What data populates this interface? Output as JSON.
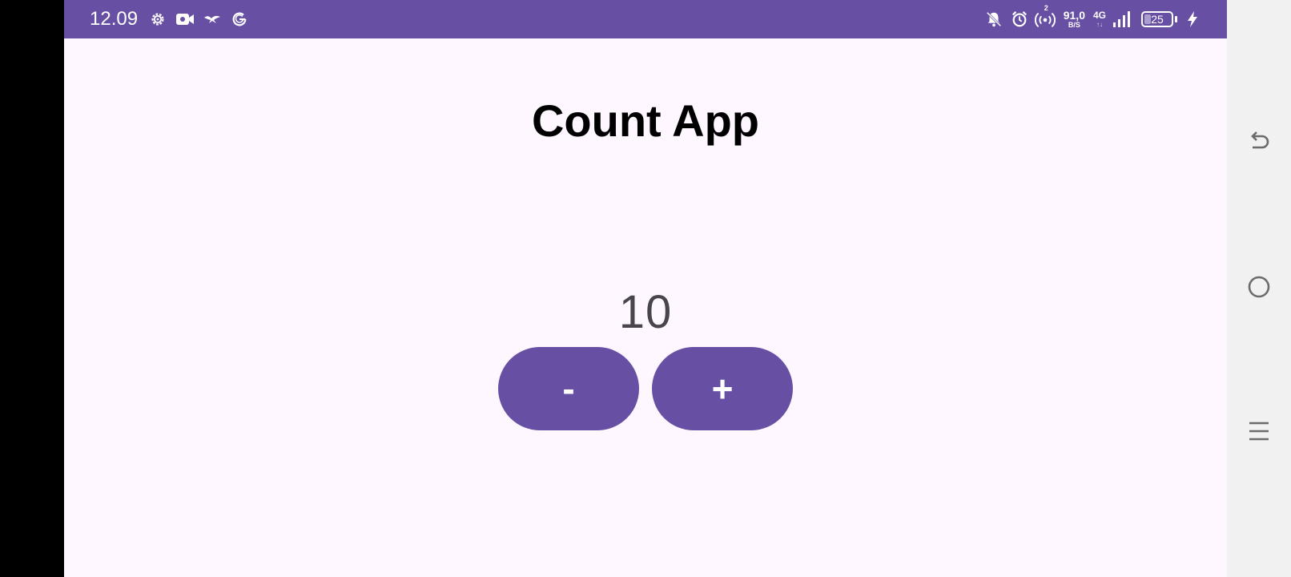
{
  "status_bar": {
    "time": "12.09",
    "left_icons": [
      "settings-gear-icon",
      "video-camera-icon",
      "bird-icon",
      "g-logo-icon"
    ],
    "net_speed_value": "91,0",
    "net_speed_unit": "B/S",
    "net_type": "4G",
    "net_type_sub": "↑↓",
    "hotspot_badge": "2",
    "battery_level": "25",
    "battery_fraction": 0.25,
    "right_icons": [
      "bell-off-icon",
      "alarm-clock-icon",
      "hotspot-icon",
      "signal-bars-icon",
      "battery-icon",
      "charging-bolt-icon"
    ]
  },
  "app": {
    "title": "Count App",
    "count_value": "10",
    "decrement_label": "-",
    "increment_label": "+"
  },
  "nav": {
    "icons": [
      "back-arrow-icon",
      "home-circle-icon",
      "recent-menu-icon"
    ]
  },
  "colors": {
    "primary": "#6750a4",
    "background": "#fef7ff",
    "count_text": "#49454f",
    "nav_bar": "#f1f1f1",
    "nav_icon": "#6b6b6b"
  }
}
